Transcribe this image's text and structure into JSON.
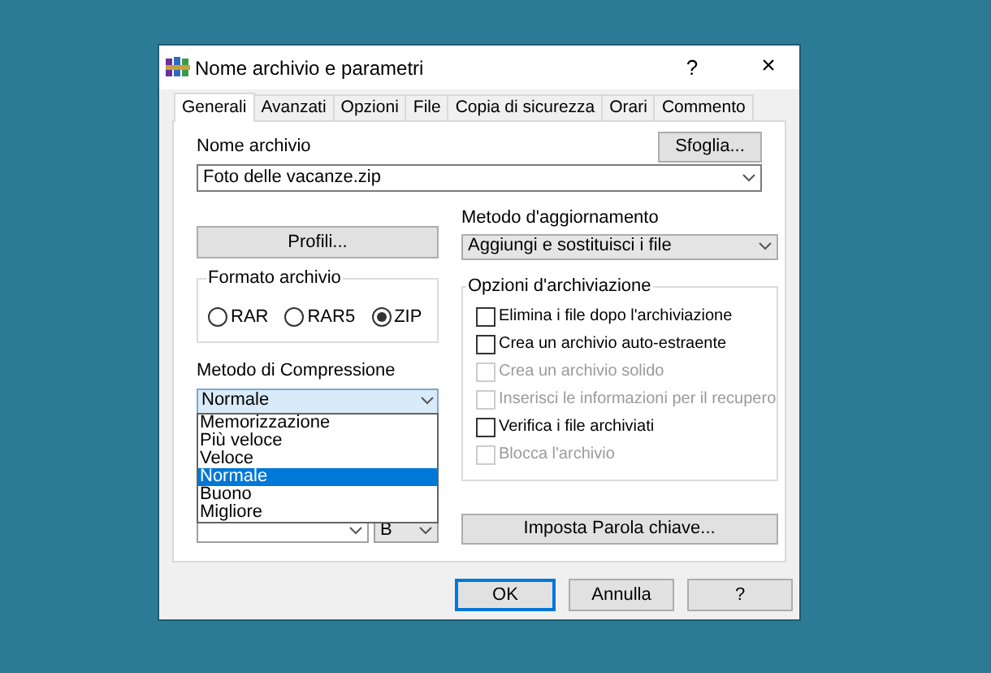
{
  "window": {
    "title": "Nome archivio e parametri",
    "help": "?",
    "close": "×"
  },
  "tabs": [
    {
      "label": "Generali",
      "selected": true
    },
    {
      "label": "Avanzati",
      "selected": false
    },
    {
      "label": "Opzioni",
      "selected": false
    },
    {
      "label": "File",
      "selected": false
    },
    {
      "label": "Copia di sicurezza",
      "selected": false
    },
    {
      "label": "Orari",
      "selected": false
    },
    {
      "label": "Commento",
      "selected": false
    }
  ],
  "archive_name": {
    "label": "Nome archivio",
    "value": "Foto delle vacanze.zip"
  },
  "browse_button": "Sfoglia...",
  "profiles_button": "Profili...",
  "update_method": {
    "label": "Metodo d'aggiornamento",
    "value": "Aggiungi e sostituisci i file"
  },
  "archive_format": {
    "title": "Formato archivio",
    "options": [
      {
        "label": "RAR",
        "selected": false
      },
      {
        "label": "RAR5",
        "selected": false
      },
      {
        "label": "ZIP",
        "selected": true
      }
    ]
  },
  "compression_method": {
    "label": "Metodo di Compressione",
    "value": "Normale",
    "options": [
      {
        "label": "Memorizzazione",
        "selected": false
      },
      {
        "label": "Più veloce",
        "selected": false
      },
      {
        "label": "Veloce",
        "selected": false
      },
      {
        "label": "Normale",
        "selected": true
      },
      {
        "label": "Buono",
        "selected": false
      },
      {
        "label": "Migliore",
        "selected": false
      }
    ]
  },
  "dictionary_unit": "B",
  "archiving_options": {
    "title": "Opzioni d'archiviazione",
    "items": [
      {
        "label": "Elimina i file dopo l'archiviazione",
        "checked": false,
        "disabled": false
      },
      {
        "label": "Crea un archivio auto-estraente",
        "checked": false,
        "disabled": false
      },
      {
        "label": "Crea un archivio solido",
        "checked": false,
        "disabled": true
      },
      {
        "label": "Inserisci le informazioni per il recupero",
        "checked": false,
        "disabled": true
      },
      {
        "label": "Verifica i file archiviati",
        "checked": false,
        "disabled": false
      },
      {
        "label": "Blocca l'archivio",
        "checked": false,
        "disabled": true
      }
    ]
  },
  "password_button": "Imposta Parola chiave...",
  "footer_buttons": [
    {
      "label": "OK",
      "default": true
    },
    {
      "label": "Annulla",
      "default": false
    },
    {
      "label": "?",
      "default": false
    }
  ]
}
